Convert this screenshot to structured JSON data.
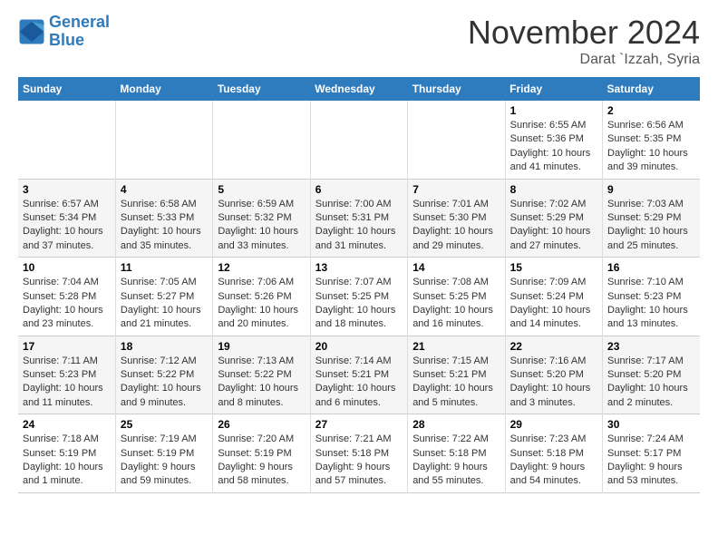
{
  "header": {
    "logo_line1": "General",
    "logo_line2": "Blue",
    "month": "November 2024",
    "location": "Darat `Izzah, Syria"
  },
  "weekdays": [
    "Sunday",
    "Monday",
    "Tuesday",
    "Wednesday",
    "Thursday",
    "Friday",
    "Saturday"
  ],
  "weeks": [
    [
      {
        "day": "",
        "info": ""
      },
      {
        "day": "",
        "info": ""
      },
      {
        "day": "",
        "info": ""
      },
      {
        "day": "",
        "info": ""
      },
      {
        "day": "",
        "info": ""
      },
      {
        "day": "1",
        "info": "Sunrise: 6:55 AM\nSunset: 5:36 PM\nDaylight: 10 hours and 41 minutes."
      },
      {
        "day": "2",
        "info": "Sunrise: 6:56 AM\nSunset: 5:35 PM\nDaylight: 10 hours and 39 minutes."
      }
    ],
    [
      {
        "day": "3",
        "info": "Sunrise: 6:57 AM\nSunset: 5:34 PM\nDaylight: 10 hours and 37 minutes."
      },
      {
        "day": "4",
        "info": "Sunrise: 6:58 AM\nSunset: 5:33 PM\nDaylight: 10 hours and 35 minutes."
      },
      {
        "day": "5",
        "info": "Sunrise: 6:59 AM\nSunset: 5:32 PM\nDaylight: 10 hours and 33 minutes."
      },
      {
        "day": "6",
        "info": "Sunrise: 7:00 AM\nSunset: 5:31 PM\nDaylight: 10 hours and 31 minutes."
      },
      {
        "day": "7",
        "info": "Sunrise: 7:01 AM\nSunset: 5:30 PM\nDaylight: 10 hours and 29 minutes."
      },
      {
        "day": "8",
        "info": "Sunrise: 7:02 AM\nSunset: 5:29 PM\nDaylight: 10 hours and 27 minutes."
      },
      {
        "day": "9",
        "info": "Sunrise: 7:03 AM\nSunset: 5:29 PM\nDaylight: 10 hours and 25 minutes."
      }
    ],
    [
      {
        "day": "10",
        "info": "Sunrise: 7:04 AM\nSunset: 5:28 PM\nDaylight: 10 hours and 23 minutes."
      },
      {
        "day": "11",
        "info": "Sunrise: 7:05 AM\nSunset: 5:27 PM\nDaylight: 10 hours and 21 minutes."
      },
      {
        "day": "12",
        "info": "Sunrise: 7:06 AM\nSunset: 5:26 PM\nDaylight: 10 hours and 20 minutes."
      },
      {
        "day": "13",
        "info": "Sunrise: 7:07 AM\nSunset: 5:25 PM\nDaylight: 10 hours and 18 minutes."
      },
      {
        "day": "14",
        "info": "Sunrise: 7:08 AM\nSunset: 5:25 PM\nDaylight: 10 hours and 16 minutes."
      },
      {
        "day": "15",
        "info": "Sunrise: 7:09 AM\nSunset: 5:24 PM\nDaylight: 10 hours and 14 minutes."
      },
      {
        "day": "16",
        "info": "Sunrise: 7:10 AM\nSunset: 5:23 PM\nDaylight: 10 hours and 13 minutes."
      }
    ],
    [
      {
        "day": "17",
        "info": "Sunrise: 7:11 AM\nSunset: 5:23 PM\nDaylight: 10 hours and 11 minutes."
      },
      {
        "day": "18",
        "info": "Sunrise: 7:12 AM\nSunset: 5:22 PM\nDaylight: 10 hours and 9 minutes."
      },
      {
        "day": "19",
        "info": "Sunrise: 7:13 AM\nSunset: 5:22 PM\nDaylight: 10 hours and 8 minutes."
      },
      {
        "day": "20",
        "info": "Sunrise: 7:14 AM\nSunset: 5:21 PM\nDaylight: 10 hours and 6 minutes."
      },
      {
        "day": "21",
        "info": "Sunrise: 7:15 AM\nSunset: 5:21 PM\nDaylight: 10 hours and 5 minutes."
      },
      {
        "day": "22",
        "info": "Sunrise: 7:16 AM\nSunset: 5:20 PM\nDaylight: 10 hours and 3 minutes."
      },
      {
        "day": "23",
        "info": "Sunrise: 7:17 AM\nSunset: 5:20 PM\nDaylight: 10 hours and 2 minutes."
      }
    ],
    [
      {
        "day": "24",
        "info": "Sunrise: 7:18 AM\nSunset: 5:19 PM\nDaylight: 10 hours and 1 minute."
      },
      {
        "day": "25",
        "info": "Sunrise: 7:19 AM\nSunset: 5:19 PM\nDaylight: 9 hours and 59 minutes."
      },
      {
        "day": "26",
        "info": "Sunrise: 7:20 AM\nSunset: 5:19 PM\nDaylight: 9 hours and 58 minutes."
      },
      {
        "day": "27",
        "info": "Sunrise: 7:21 AM\nSunset: 5:18 PM\nDaylight: 9 hours and 57 minutes."
      },
      {
        "day": "28",
        "info": "Sunrise: 7:22 AM\nSunset: 5:18 PM\nDaylight: 9 hours and 55 minutes."
      },
      {
        "day": "29",
        "info": "Sunrise: 7:23 AM\nSunset: 5:18 PM\nDaylight: 9 hours and 54 minutes."
      },
      {
        "day": "30",
        "info": "Sunrise: 7:24 AM\nSunset: 5:17 PM\nDaylight: 9 hours and 53 minutes."
      }
    ]
  ]
}
